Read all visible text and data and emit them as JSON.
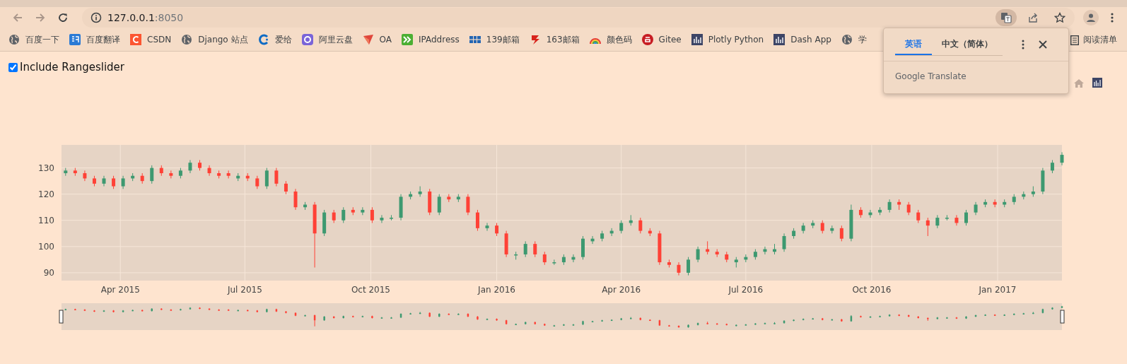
{
  "browser": {
    "address": {
      "host": "127.0.0.1",
      "port": ":8050"
    },
    "bookmarks": [
      {
        "label": "百度一下",
        "kind": "globe"
      },
      {
        "label": "百度翻译",
        "kind": "translate"
      },
      {
        "label": "CSDN",
        "kind": "csdn"
      },
      {
        "label": "Django 站点",
        "kind": "globe"
      },
      {
        "label": "爱给",
        "kind": "ring"
      },
      {
        "label": "阿里云盘",
        "kind": "cloud"
      },
      {
        "label": "OA",
        "kind": "arrow"
      },
      {
        "label": "IPAddress",
        "kind": "chevrons"
      },
      {
        "label": "139邮箱",
        "kind": "bars"
      },
      {
        "label": "163邮箱",
        "kind": "redmail"
      },
      {
        "label": "颜色码",
        "kind": "rainbow"
      },
      {
        "label": "Gitee",
        "kind": "gitee"
      },
      {
        "label": "Plotly Python",
        "kind": "dashboard"
      },
      {
        "label": "Dash App",
        "kind": "dashboard"
      },
      {
        "label": "学",
        "kind": "globe"
      }
    ],
    "reading_list": "阅读清单"
  },
  "translate_popup": {
    "tabs": [
      {
        "label": "英语",
        "selected": true
      },
      {
        "label": "中文（简体）",
        "selected": false
      }
    ],
    "brand": "Google Translate"
  },
  "page": {
    "checkbox": {
      "label": "Include Rangeslider",
      "checked": true
    },
    "chart": {
      "rangeslider": true,
      "chart_data": {
        "type": "candlestick",
        "x": [
          "2015-02-20",
          "2015-02-27",
          "2015-03-06",
          "2015-03-13",
          "2015-03-20",
          "2015-03-27",
          "2015-04-03",
          "2015-04-10",
          "2015-04-17",
          "2015-04-24",
          "2015-05-01",
          "2015-05-08",
          "2015-05-15",
          "2015-05-22",
          "2015-05-29",
          "2015-06-05",
          "2015-06-12",
          "2015-06-19",
          "2015-06-26",
          "2015-07-03",
          "2015-07-10",
          "2015-07-17",
          "2015-07-24",
          "2015-07-31",
          "2015-08-07",
          "2015-08-14",
          "2015-08-21",
          "2015-08-28",
          "2015-09-04",
          "2015-09-11",
          "2015-09-18",
          "2015-09-25",
          "2015-10-02",
          "2015-10-09",
          "2015-10-16",
          "2015-10-23",
          "2015-10-30",
          "2015-11-06",
          "2015-11-13",
          "2015-11-20",
          "2015-11-27",
          "2015-12-04",
          "2015-12-11",
          "2015-12-18",
          "2015-12-25",
          "2016-01-01",
          "2016-01-08",
          "2016-01-15",
          "2016-01-22",
          "2016-01-29",
          "2016-02-05",
          "2016-02-12",
          "2016-02-19",
          "2016-02-26",
          "2016-03-04",
          "2016-03-11",
          "2016-03-18",
          "2016-03-25",
          "2016-04-01",
          "2016-04-08",
          "2016-04-15",
          "2016-04-22",
          "2016-04-29",
          "2016-05-06",
          "2016-05-13",
          "2016-05-20",
          "2016-05-27",
          "2016-06-03",
          "2016-06-10",
          "2016-06-17",
          "2016-06-24",
          "2016-07-01",
          "2016-07-08",
          "2016-07-15",
          "2016-07-22",
          "2016-07-29",
          "2016-08-05",
          "2016-08-12",
          "2016-08-19",
          "2016-08-26",
          "2016-09-02",
          "2016-09-09",
          "2016-09-16",
          "2016-09-23",
          "2016-09-30",
          "2016-10-07",
          "2016-10-14",
          "2016-10-21",
          "2016-10-28",
          "2016-11-04",
          "2016-11-11",
          "2016-11-18",
          "2016-11-25",
          "2016-12-02",
          "2016-12-09",
          "2016-12-16",
          "2016-12-23",
          "2016-12-30",
          "2017-01-06",
          "2017-01-13",
          "2017-01-20",
          "2017-01-27",
          "2017-02-03",
          "2017-02-10",
          "2017-02-17"
        ],
        "ohlc": [
          [
            128,
            130,
            127,
            129
          ],
          [
            129,
            130,
            127,
            128
          ],
          [
            128,
            129,
            125,
            126
          ],
          [
            126,
            127,
            123,
            124
          ],
          [
            124,
            127,
            123,
            126
          ],
          [
            126,
            127,
            122,
            123
          ],
          [
            123,
            127,
            122,
            126
          ],
          [
            126,
            128,
            125,
            127
          ],
          [
            127,
            128,
            124,
            125
          ],
          [
            125,
            131,
            124,
            130
          ],
          [
            130,
            131,
            127,
            128
          ],
          [
            128,
            129,
            126,
            127
          ],
          [
            127,
            130,
            126,
            129
          ],
          [
            129,
            133,
            128,
            132
          ],
          [
            132,
            133,
            129,
            130
          ],
          [
            130,
            131,
            127,
            128
          ],
          [
            128,
            129,
            126,
            127
          ],
          [
            128,
            129,
            126,
            127
          ],
          [
            126,
            128,
            125,
            127
          ],
          [
            127,
            128,
            125,
            126
          ],
          [
            126,
            127,
            122,
            123
          ],
          [
            123,
            130,
            122,
            129
          ],
          [
            129,
            130,
            123,
            124
          ],
          [
            124,
            125,
            120,
            121
          ],
          [
            121,
            122,
            114,
            115
          ],
          [
            115,
            117,
            114,
            116
          ],
          [
            116,
            117,
            92,
            105
          ],
          [
            105,
            114,
            104,
            113
          ],
          [
            113,
            114,
            109,
            110
          ],
          [
            110,
            115,
            109,
            114
          ],
          [
            114,
            115,
            112,
            113
          ],
          [
            113,
            115,
            112,
            114
          ],
          [
            114,
            115,
            109,
            110
          ],
          [
            110,
            112,
            109,
            111
          ],
          [
            111,
            112,
            110,
            111
          ],
          [
            111,
            120,
            110,
            119
          ],
          [
            119,
            121,
            118,
            120
          ],
          [
            120,
            123,
            119,
            121
          ],
          [
            121,
            122,
            112,
            113
          ],
          [
            113,
            120,
            112,
            119
          ],
          [
            119,
            120,
            117,
            118
          ],
          [
            118,
            120,
            117,
            119
          ],
          [
            119,
            120,
            112,
            113
          ],
          [
            113,
            114,
            106,
            107
          ],
          [
            107,
            109,
            106,
            108
          ],
          [
            108,
            109,
            104,
            105
          ],
          [
            105,
            106,
            96,
            97
          ],
          [
            97,
            98,
            95,
            97
          ],
          [
            97,
            102,
            96,
            101
          ],
          [
            101,
            102,
            96,
            97
          ],
          [
            97,
            98,
            93,
            94
          ],
          [
            94,
            95,
            93,
            94
          ],
          [
            94,
            97,
            93,
            96
          ],
          [
            95,
            97,
            94,
            96
          ],
          [
            96,
            104,
            95,
            103
          ],
          [
            102,
            104,
            101,
            103
          ],
          [
            103,
            106,
            102,
            105
          ],
          [
            105,
            107,
            104,
            106
          ],
          [
            106,
            110,
            105,
            109
          ],
          [
            109,
            112,
            108,
            110
          ],
          [
            110,
            111,
            105,
            106
          ],
          [
            106,
            107,
            104,
            105
          ],
          [
            105,
            106,
            93,
            94
          ],
          [
            94,
            95,
            92,
            93
          ],
          [
            93,
            94,
            89,
            90
          ],
          [
            90,
            96,
            89,
            95
          ],
          [
            95,
            100,
            94,
            99
          ],
          [
            99,
            102,
            97,
            98
          ],
          [
            98,
            99,
            96,
            97
          ],
          [
            97,
            98,
            94,
            95
          ],
          [
            94,
            96,
            92,
            95
          ],
          [
            95,
            97,
            94,
            96
          ],
          [
            96,
            99,
            95,
            98
          ],
          [
            98,
            100,
            97,
            99
          ],
          [
            98,
            101,
            97,
            99
          ],
          [
            99,
            105,
            98,
            104
          ],
          [
            104,
            107,
            103,
            106
          ],
          [
            106,
            109,
            105,
            108
          ],
          [
            108,
            110,
            107,
            109
          ],
          [
            109,
            110,
            105,
            106
          ],
          [
            106,
            108,
            105,
            107
          ],
          [
            107,
            108,
            102,
            103
          ],
          [
            103,
            116,
            102,
            114
          ],
          [
            114,
            115,
            111,
            112
          ],
          [
            112,
            114,
            111,
            113
          ],
          [
            113,
            115,
            112,
            114
          ],
          [
            114,
            118,
            113,
            117
          ],
          [
            117,
            118,
            114,
            116
          ],
          [
            116,
            117,
            112,
            113
          ],
          [
            113,
            114,
            109,
            110
          ],
          [
            110,
            111,
            104,
            108
          ],
          [
            108,
            112,
            107,
            111
          ],
          [
            111,
            112,
            110,
            111
          ],
          [
            111,
            112,
            108,
            109
          ],
          [
            109,
            114,
            108,
            113
          ],
          [
            113,
            117,
            112,
            116
          ],
          [
            116,
            118,
            115,
            117
          ],
          [
            117,
            118,
            115,
            116
          ],
          [
            116,
            118,
            115,
            117
          ],
          [
            117,
            120,
            116,
            119
          ],
          [
            119,
            121,
            118,
            120
          ],
          [
            120,
            123,
            119,
            121
          ],
          [
            121,
            130,
            120,
            129
          ],
          [
            129,
            133,
            128,
            132
          ],
          [
            132,
            136,
            131,
            135
          ]
        ],
        "grid": true,
        "xlim": [
          "2015-02-17",
          "2017-02-17"
        ],
        "ylim": [
          87,
          138.8
        ],
        "xticks": [
          {
            "value": "2015-04-01",
            "label": "Apr 2015"
          },
          {
            "value": "2015-07-01",
            "label": "Jul 2015"
          },
          {
            "value": "2015-10-01",
            "label": "Oct 2015"
          },
          {
            "value": "2016-01-01",
            "label": "Jan 2016"
          },
          {
            "value": "2016-04-01",
            "label": "Apr 2016"
          },
          {
            "value": "2016-07-01",
            "label": "Jul 2016"
          },
          {
            "value": "2016-10-01",
            "label": "Oct 2016"
          },
          {
            "value": "2017-01-01",
            "label": "Jan 2017"
          }
        ],
        "yticks": [
          90,
          100,
          110,
          120,
          130
        ]
      }
    }
  }
}
